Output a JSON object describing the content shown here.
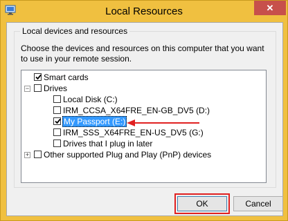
{
  "window": {
    "title": "Local Resources",
    "close_label": "✕"
  },
  "group": {
    "title": "Local devices and resources",
    "description": "Choose the devices and resources on this computer that you want to use in your remote session."
  },
  "tree": {
    "smart_cards": "Smart cards",
    "drives": "Drives",
    "local_disk": "Local Disk (C:)",
    "irm_ccsa": "IRM_CCSA_X64FRE_EN-GB_DV5 (D:)",
    "my_passport": "My Passport (E:)",
    "irm_sss": "IRM_SSS_X64FRE_EN-US_DV5 (G:)",
    "drives_later": "Drives that I plug in later",
    "pnp_devices": "Other supported Plug and Play (PnP) devices",
    "expander_minus": "−",
    "expander_plus": "+"
  },
  "buttons": {
    "ok": "OK",
    "cancel": "Cancel"
  },
  "colors": {
    "frame": "#f0c040",
    "selection": "#3399ff",
    "highlight": "#e02020"
  }
}
